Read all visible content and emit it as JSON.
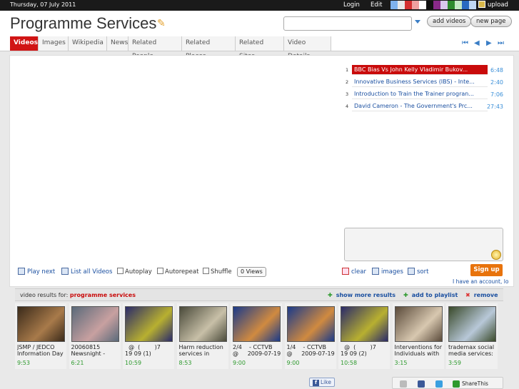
{
  "topbar": {
    "date": "Thursday, 07 July 2011",
    "login": "Login",
    "edit": "Edit",
    "upload": "upload",
    "swatches": [
      "#7fb2ee",
      "#e8e8e8",
      "#d43030",
      "#f0a0a0",
      "#ffffff",
      "#111111",
      "#8a2a8a",
      "#d8c8ec",
      "#2d8a2d",
      "#c4e8c4",
      "#2a6ac0",
      "#c0d8f4"
    ]
  },
  "header": {
    "title": "Programme Services",
    "search_placeholder": "",
    "add_videos": "add videos",
    "new_page": "new page"
  },
  "tabs": [
    "Videos",
    "Images",
    "Wikipedia",
    "News",
    "Related People",
    "Related Places",
    "Related Sites",
    "Video Details"
  ],
  "active_tab": "Videos",
  "playlist": [
    {
      "num": "1",
      "title": "BBC Bias Vs John Kelly Vladimir Bukov...",
      "duration": "6:48",
      "selected": true
    },
    {
      "num": "2",
      "title": "Innovative Business Services (IBS) - Inte...",
      "duration": "2:40",
      "selected": false
    },
    {
      "num": "3",
      "title": "Introduction to Train the Trainer progran...",
      "duration": "7:06",
      "selected": false
    },
    {
      "num": "4",
      "title": "David Cameron - The Government's Prc...",
      "duration": "27:43",
      "selected": false
    }
  ],
  "controls": {
    "play_next": "Play next",
    "list_all": "List all Videos",
    "autoplay": "Autoplay",
    "autorepeat": "Autorepeat",
    "shuffle": "Shuffle",
    "views": "0 Views",
    "clear": "clear",
    "images": "images",
    "sort": "sort",
    "sign_up": "Sign up",
    "have_account": "I have an account, lo"
  },
  "results": {
    "label": "video results for:",
    "query": "programme services",
    "show_more": "show more results",
    "add_playlist": "add to playlist",
    "remove": "remove"
  },
  "thumbs": [
    {
      "caption": "JSMP / JEDCO\nInformation Day",
      "duration": "9:53"
    },
    {
      "caption": "20060815\nNewsnight -",
      "duration": "6:21"
    },
    {
      "caption": "  @  (        )7\n19 09 (1)",
      "duration": "10:59"
    },
    {
      "caption": "Harm reduction\nservices in",
      "duration": "8:53"
    },
    {
      "caption": "2/4    - CCTVB\n@     2009-07-19",
      "duration": "9:00"
    },
    {
      "caption": "1/4    - CCTVB\n@     2009-07-19",
      "duration": "9:00"
    },
    {
      "caption": "  @  (        )7\n19 09 (2)",
      "duration": "10:58"
    },
    {
      "caption": "Interventions for\nIndividuals with",
      "duration": "3:15"
    },
    {
      "caption": "trademax social\nmedia services:",
      "duration": "3:59"
    }
  ],
  "footer": {
    "like": "Like",
    "share": "ShareThis"
  }
}
